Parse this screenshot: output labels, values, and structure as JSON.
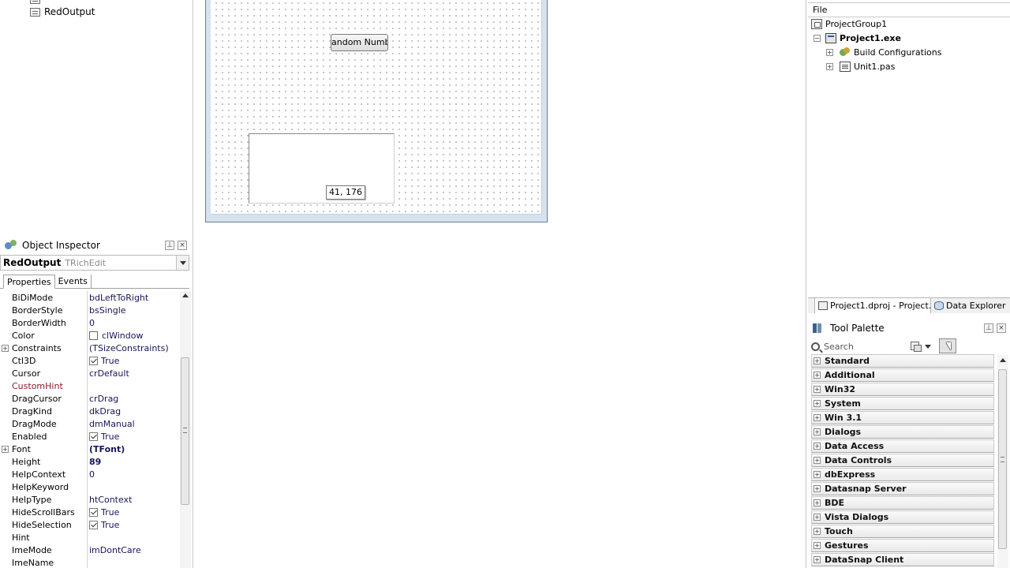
{
  "structure": {
    "items": [
      "RedOutput"
    ]
  },
  "object_inspector": {
    "title": "Object Inspector",
    "selected_object": "RedOutput",
    "selected_class": "TRichEdit",
    "tabs": [
      "Properties",
      "Events"
    ],
    "properties": [
      {
        "name": "BiDiMode",
        "value": "bdLeftToRight"
      },
      {
        "name": "BorderStyle",
        "value": "bsSingle"
      },
      {
        "name": "BorderWidth",
        "value": "0"
      },
      {
        "name": "Color",
        "value": "clWindow"
      },
      {
        "name": "Constraints",
        "value": "(TSizeConstraints)"
      },
      {
        "name": "Ctl3D",
        "value": "True"
      },
      {
        "name": "Cursor",
        "value": "crDefault"
      },
      {
        "name": "CustomHint",
        "value": ""
      },
      {
        "name": "DragCursor",
        "value": "crDrag"
      },
      {
        "name": "DragKind",
        "value": "dkDrag"
      },
      {
        "name": "DragMode",
        "value": "dmManual"
      },
      {
        "name": "Enabled",
        "value": "True"
      },
      {
        "name": "Font",
        "value": "(TFont)"
      },
      {
        "name": "Height",
        "value": "89"
      },
      {
        "name": "HelpContext",
        "value": "0"
      },
      {
        "name": "HelpKeyword",
        "value": ""
      },
      {
        "name": "HelpType",
        "value": "htContext"
      },
      {
        "name": "HideScrollBars",
        "value": "True"
      },
      {
        "name": "HideSelection",
        "value": "True"
      },
      {
        "name": "Hint",
        "value": ""
      },
      {
        "name": "ImeMode",
        "value": "imDontCare"
      },
      {
        "name": "ImeName",
        "value": ""
      }
    ]
  },
  "designer": {
    "button_caption": "andom Numbe",
    "coord_tooltip": "41, 176"
  },
  "project_manager": {
    "menu_file": "File",
    "group": "ProjectGroup1",
    "project": "Project1.exe",
    "build_configs": "Build Configurations",
    "unit": "Unit1.pas",
    "tab_project": "Project1.dproj - Project...",
    "tab_data_explorer": "Data Explorer"
  },
  "tool_palette": {
    "title": "Tool Palette",
    "search_placeholder": "Search",
    "categories": [
      "Standard",
      "Additional",
      "Win32",
      "System",
      "Win 3.1",
      "Dialogs",
      "Data Access",
      "Data Controls",
      "dbExpress",
      "Datasnap Server",
      "BDE",
      "Vista Dialogs",
      "Touch",
      "Gestures",
      "DataSnap Client"
    ]
  }
}
